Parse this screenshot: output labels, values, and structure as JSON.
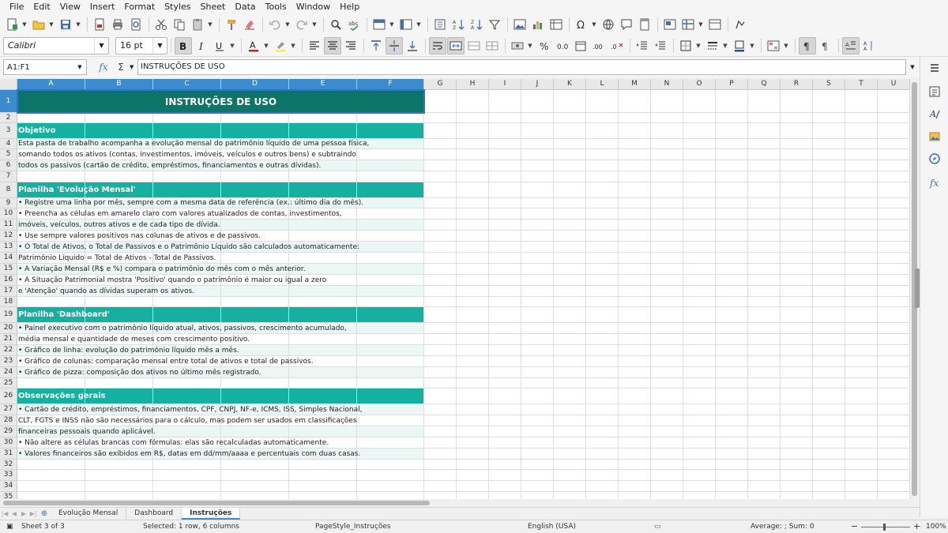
{
  "menu": [
    "File",
    "Edit",
    "View",
    "Insert",
    "Format",
    "Styles",
    "Sheet",
    "Data",
    "Tools",
    "Window",
    "Help"
  ],
  "font": {
    "name": "Calibri",
    "size": "16 pt"
  },
  "namebox": "A1:F1",
  "formula": "INSTRUÇÕES DE USO",
  "columns": [
    "A",
    "B",
    "C",
    "D",
    "E",
    "F",
    "G",
    "H",
    "I",
    "J",
    "K",
    "L",
    "M",
    "N",
    "O",
    "P",
    "Q",
    "R",
    "S",
    "T",
    "U"
  ],
  "rows": [
    "1",
    "2",
    "3",
    "4",
    "5",
    "6",
    "7",
    "8",
    "9",
    "10",
    "11",
    "12",
    "13",
    "14",
    "15",
    "16",
    "17",
    "18",
    "19",
    "20",
    "21",
    "22",
    "23",
    "24",
    "25",
    "26",
    "27",
    "28",
    "29",
    "30",
    "31",
    "32",
    "33",
    "34",
    "35"
  ],
  "title": "INSTRUÇÕES DE USO",
  "cells": {
    "r3": "Objetivo",
    "r4": "Esta pasta de trabalho acompanha a evolução mensal do patrimônio líquido de uma pessoa física,",
    "r5": "somando todos os ativos (contas, investimentos, imóveis, veículos e outros bens) e subtraindo",
    "r6": "todos os passivos (cartão de crédito, empréstimos, financiamentos e outras dívidas).",
    "r8": "Planilha 'Evolução Mensal'",
    "r9": "• Registre uma linha por mês, sempre com a mesma data de referência (ex.: último dia do mês).",
    "r10": "• Preencha as células em amarelo claro com valores atualizados de contas, investimentos,",
    "r11": "  imóveis, veículos, outros ativos e de cada tipo de dívida.",
    "r12": "• Use sempre valores positivos nas colunas de ativos e de passivos.",
    "r13": "• O Total de Ativos, o Total de Passivos e o Patrimônio Líquido são calculados automaticamente:",
    "r14": "  Patrimônio Líquido = Total de Ativos - Total de Passivos.",
    "r15": "• A Variação Mensal (R$ e %) compara o patrimônio do mês com o mês anterior.",
    "r16": "• A Situação Patrimonial mostra 'Positivo' quando o patrimônio é maior ou igual a zero",
    "r17": "  e 'Atenção' quando as dívidas superam os ativos.",
    "r19": "Planilha 'Dashboard'",
    "r20": "• Painel executivo com o patrimônio líquido atual, ativos, passivos, crescimento acumulado,",
    "r21": "  média mensal e quantidade de meses com crescimento positivo.",
    "r22": "• Gráfico de linha: evolução do patrimônio líquido mês a mês.",
    "r23": "• Gráfico de colunas: comparação mensal entre total de ativos e total de passivos.",
    "r24": "• Gráfico de pizza: composição dos ativos no último mês registrado.",
    "r26": "Observações gerais",
    "r27": "• Cartão de crédito, empréstimos, financiamentos, CPF, CNPJ, NF-e, ICMS, ISS, Simples Nacional,",
    "r28": "  CLT, FGTS e INSS não são necessários para o cálculo, mas podem ser usados em classificações",
    "r29": "  financeiras pessoais quando aplicável.",
    "r30": "• Não altere as células brancas com fórmulas: elas são recalculadas automaticamente.",
    "r31": "• Valores financeiros são exibidos em R$, datas em dd/mm/aaaa e percentuais com duas casas."
  },
  "tabs": [
    "Evolução Mensal",
    "Dashboard",
    "Instruções"
  ],
  "active_tab": "Instruções",
  "status": {
    "sheet": "Sheet 3 of 3",
    "selection": "Selected: 1 row, 6 columns",
    "pagestyle": "PageStyle_Instruções",
    "language": "English (USA)",
    "summary": "Average: ; Sum: 0",
    "zoom": "100%"
  },
  "colors": {
    "title": "#0d7468",
    "section": "#15b09f",
    "band": "#eaf7f4",
    "selection": "#3a8ccf"
  }
}
